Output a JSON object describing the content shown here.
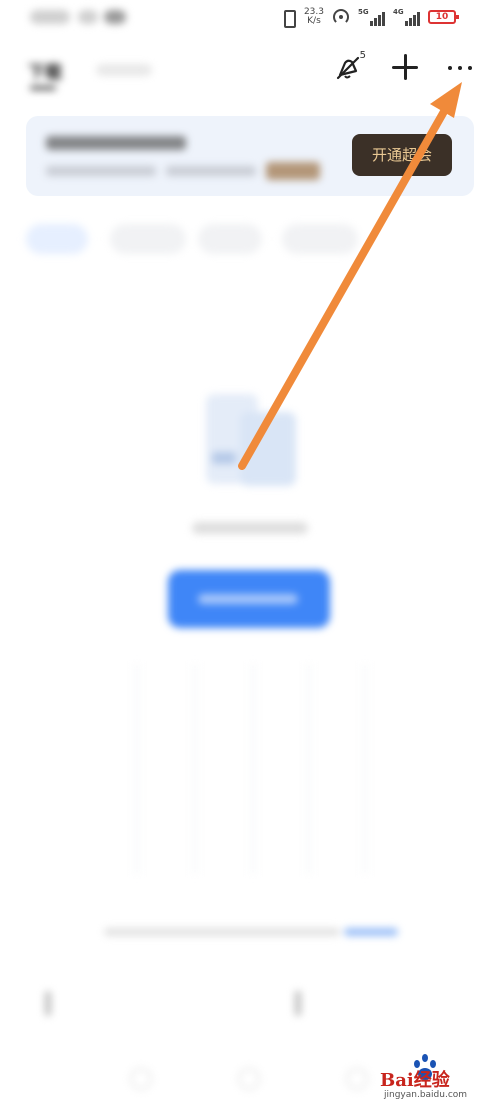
{
  "status_bar": {
    "network_speed": "23.3\nK/s",
    "sim1_tag": "5G",
    "sim2_tag": "4G",
    "battery": "10"
  },
  "header": {
    "active_tab": "下载",
    "inactive_tab": "",
    "notify_badge": "5"
  },
  "banner": {
    "title": "",
    "subtitle": "",
    "vip_button": "开通超会"
  },
  "filter_chips": [
    "",
    "",
    "",
    "",
    ""
  ],
  "empty_state": {
    "message": "",
    "button": ""
  },
  "footer_note": "",
  "watermark": {
    "text": "Bai经验",
    "url": "jingyan.baidu.com"
  },
  "colors": {
    "primary": "#3f86f7",
    "vip_bg": "#3b3027",
    "vip_text": "#e9c893",
    "arrow": "#f08a3a",
    "battery_low": "#dd3333"
  },
  "icons": {
    "notify": "bell-slash-icon",
    "add": "plus-icon",
    "more": "more-dots-icon",
    "pointer": "annotation-arrow-icon"
  }
}
